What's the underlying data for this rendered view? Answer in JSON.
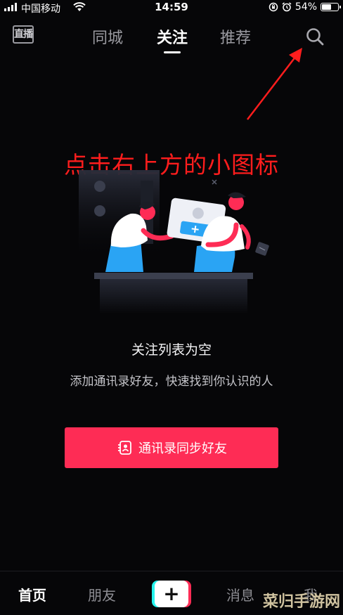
{
  "status_bar": {
    "carrier": "中国移动",
    "time": "14:59",
    "battery": "54%",
    "battery_level": 0.54,
    "icons": [
      "signal-icon",
      "wifi-icon",
      "rotation-lock-icon",
      "alarm-icon",
      "battery-icon"
    ]
  },
  "header": {
    "live_label": "直播",
    "tabs": [
      {
        "label": "同城",
        "active": false
      },
      {
        "label": "关注",
        "active": true
      },
      {
        "label": "推荐",
        "active": false
      }
    ],
    "search_icon": "search-icon"
  },
  "annotation": {
    "text": "点击右上方的小图标",
    "color": "#ff1d1d"
  },
  "empty_state": {
    "title": "关注列表为空",
    "subtitle": "添加通讯录好友，快速找到你认识的人",
    "button_label": "通讯录同步好友",
    "button_icon": "contacts-icon",
    "button_color": "#fe2c55"
  },
  "bottom_nav": {
    "items": [
      {
        "label": "首页",
        "active": true
      },
      {
        "label": "朋友",
        "active": false
      },
      {
        "label": "消息",
        "active": false
      },
      {
        "label": "我",
        "active": false
      }
    ],
    "create_icon": "plus-icon"
  },
  "watermark": "菜归手游网",
  "colors": {
    "background": "#060608",
    "accent": "#fe2c55",
    "cyan": "#25f4ee"
  }
}
